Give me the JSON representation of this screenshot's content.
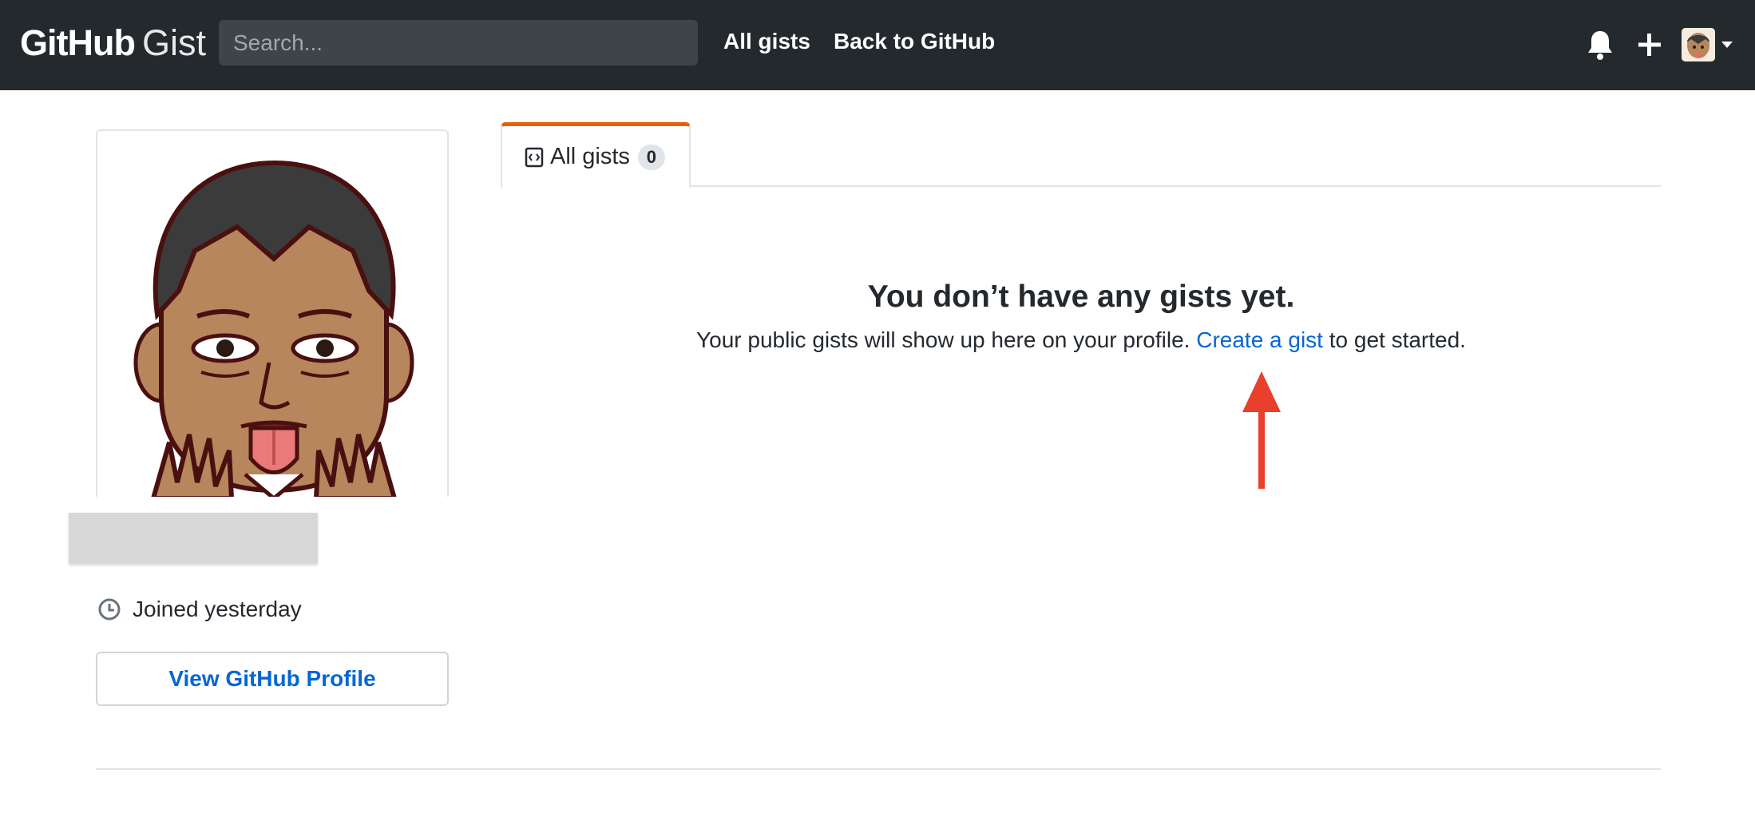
{
  "header": {
    "logo_github": "GitHub",
    "logo_gist": "Gist",
    "search_placeholder": "Search...",
    "nav": [
      {
        "label": "All gists"
      },
      {
        "label": "Back to GitHub"
      }
    ],
    "icons": [
      "bell-icon",
      "plus-icon",
      "avatar",
      "caret-down-icon"
    ]
  },
  "sidebar": {
    "joined_text": "Joined yesterday",
    "profile_button": "View GitHub Profile"
  },
  "main": {
    "tab": {
      "label": "All gists",
      "count": "0",
      "icon": "code-square-icon"
    },
    "blank_title": "You don’t have any gists yet.",
    "blank_desc_before": "Your public gists will show up here on your profile.",
    "blank_link": "Create a gist",
    "blank_desc_after": "to get started."
  },
  "colors": {
    "header_bg": "#24292e",
    "link": "#0366d6",
    "tab_accent": "#e36209",
    "annotation_arrow": "#e8402c"
  }
}
